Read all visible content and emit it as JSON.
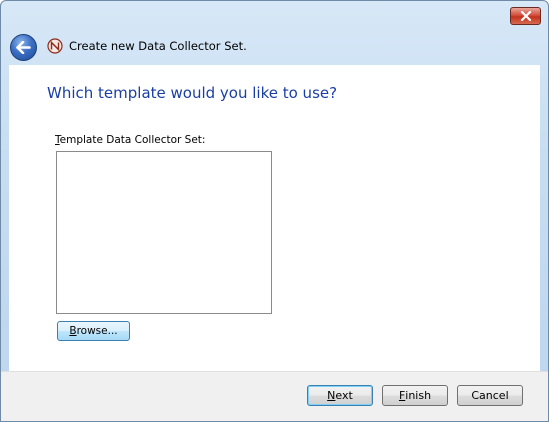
{
  "window": {
    "title": "Create new Data Collector Set."
  },
  "icons": {
    "close": "close-icon",
    "back": "back-arrow-icon",
    "app": "data-collector-set-icon"
  },
  "page": {
    "heading": "Which template would you like to use?",
    "template_label_mnemonic": "T",
    "template_label_rest": "emplate Data Collector Set:",
    "template_items": []
  },
  "browse": {
    "mnemonic": "B",
    "rest": "rowse..."
  },
  "buttons": {
    "next_mnemonic": "N",
    "next_rest": "ext",
    "finish_mnemonic": "F",
    "finish_rest": "inish",
    "cancel": "Cancel"
  },
  "colors": {
    "heading": "#1a3ea6",
    "close_button": "#c2321c",
    "footer": "#f0f0f0"
  }
}
